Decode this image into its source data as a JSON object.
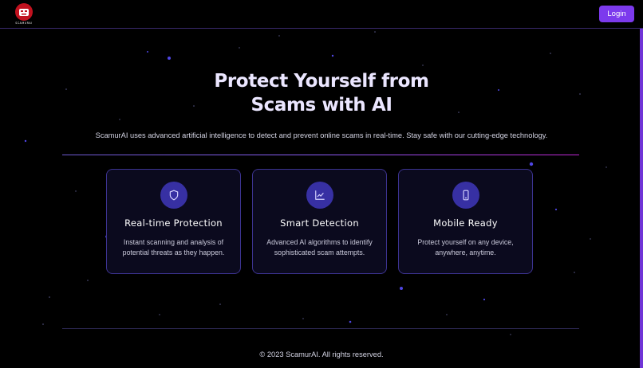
{
  "header": {
    "logo_alt": "SCAMURAI",
    "login_label": "Login"
  },
  "hero": {
    "title_line1": "Protect Yourself from",
    "title_line2": "Scams with AI",
    "subtitle": "ScamurAI uses advanced artificial intelligence to detect and prevent online scams in real-time. Stay safe with our cutting-edge technology."
  },
  "features": [
    {
      "icon": "shield-icon",
      "title": "Real-time Protection",
      "desc_line1": "Instant scanning and analysis of",
      "desc_line2": "potential threats as they happen."
    },
    {
      "icon": "chart-icon",
      "title": "Smart Detection",
      "desc_line1": "Advanced AI algorithms to identify",
      "desc_line2": "sophisticated scam attempts."
    },
    {
      "icon": "smartphone-icon",
      "title": "Mobile Ready",
      "desc_line1": "Protect yourself on any device,",
      "desc_line2": "anywhere, anytime."
    }
  ],
  "footer": {
    "copyright": "© 2023 ScamurAI. All rights reserved."
  },
  "colors": {
    "background": "#000000",
    "accent": "#7c3aed",
    "card_bg": "#0b0a1e",
    "card_border": "#3c3390",
    "icon_bg": "#3730a3"
  }
}
